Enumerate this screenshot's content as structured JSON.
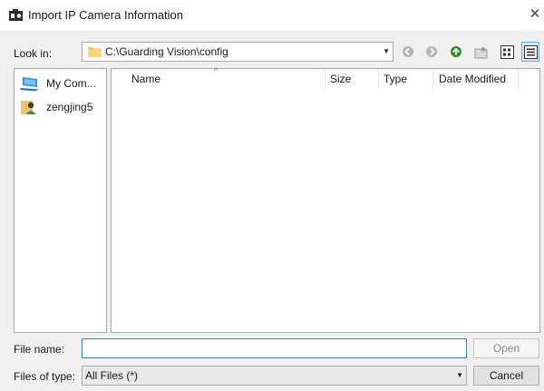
{
  "window": {
    "title": "Import IP Camera Information",
    "close_glyph": "✕"
  },
  "lookin": {
    "label": "Look in:",
    "value": "C:\\Guarding Vision\\config"
  },
  "toolbar": {
    "icons": [
      "back-icon",
      "forward-icon",
      "up-folder-icon",
      "new-folder-icon",
      "list-view-icon",
      "details-view-icon"
    ]
  },
  "places": {
    "items": [
      {
        "label": "My Com...",
        "icon": "computer-icon"
      },
      {
        "label": "zengjing5",
        "icon": "user-folder-icon"
      }
    ]
  },
  "filelist": {
    "columns": [
      "Name",
      "Size",
      "Type",
      "Date Modified"
    ],
    "sort_indicator": "^"
  },
  "filename": {
    "label": "File name:",
    "value": "",
    "open_label": "Open"
  },
  "filetype": {
    "label": "Files of type:",
    "value": "All Files (*)",
    "cancel_label": "Cancel"
  },
  "colors": {
    "client_bg": "#f0f0f0",
    "focus_border": "#3c7fb1",
    "folder": "#f3c95a",
    "up_arrow_green": "#2e8b2e"
  }
}
